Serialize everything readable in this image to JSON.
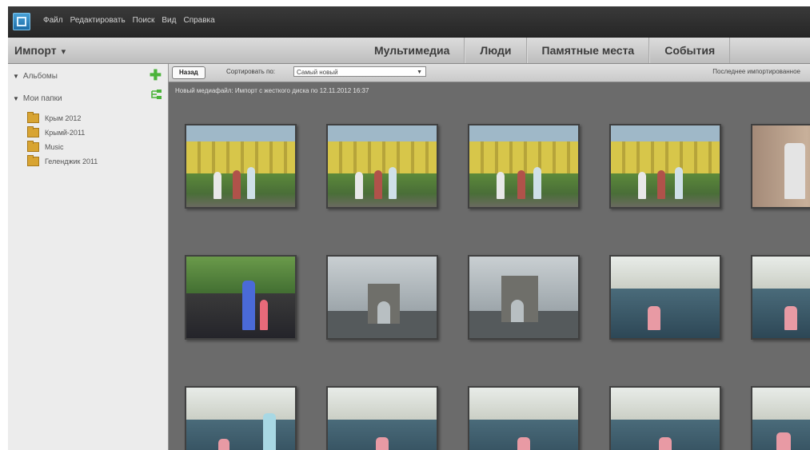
{
  "menu": {
    "items": [
      "Файл",
      "Редактировать",
      "Поиск",
      "Вид",
      "Справка"
    ]
  },
  "header": {
    "import_label": "Импорт",
    "import_chevron": "▾",
    "tabs": [
      "Мультимедиа",
      "Люди",
      "Памятные места",
      "События"
    ]
  },
  "sidebar": {
    "albums_label": "Альбомы",
    "folders_label": "Мои папки",
    "folders": [
      "Крым 2012",
      "Крымй-2011",
      "Music",
      "Геленджик 2011"
    ]
  },
  "toolbar": {
    "back_label": "Назад",
    "sort_label": "Сортировать по:",
    "sort_value": "Самый новый",
    "last_import_label": "Последнее импортированное"
  },
  "grid": {
    "import_info": "Новый медиафайл: Импорт с жесткого диска по 12.11.2012 16:37",
    "thumbnail_count": 15
  },
  "icons": {
    "app_logo": "photo-organizer-logo-icon",
    "add": "plus-icon",
    "folder": "folder-icon",
    "dropdown": "chevron-down-icon"
  },
  "colors": {
    "grid_background": "#6b6b6b",
    "sidebar_background": "#ececec",
    "menubar_background": "#2e2e2e",
    "add_icon": "#4bb33a",
    "folder_icon": "#d8a432"
  }
}
